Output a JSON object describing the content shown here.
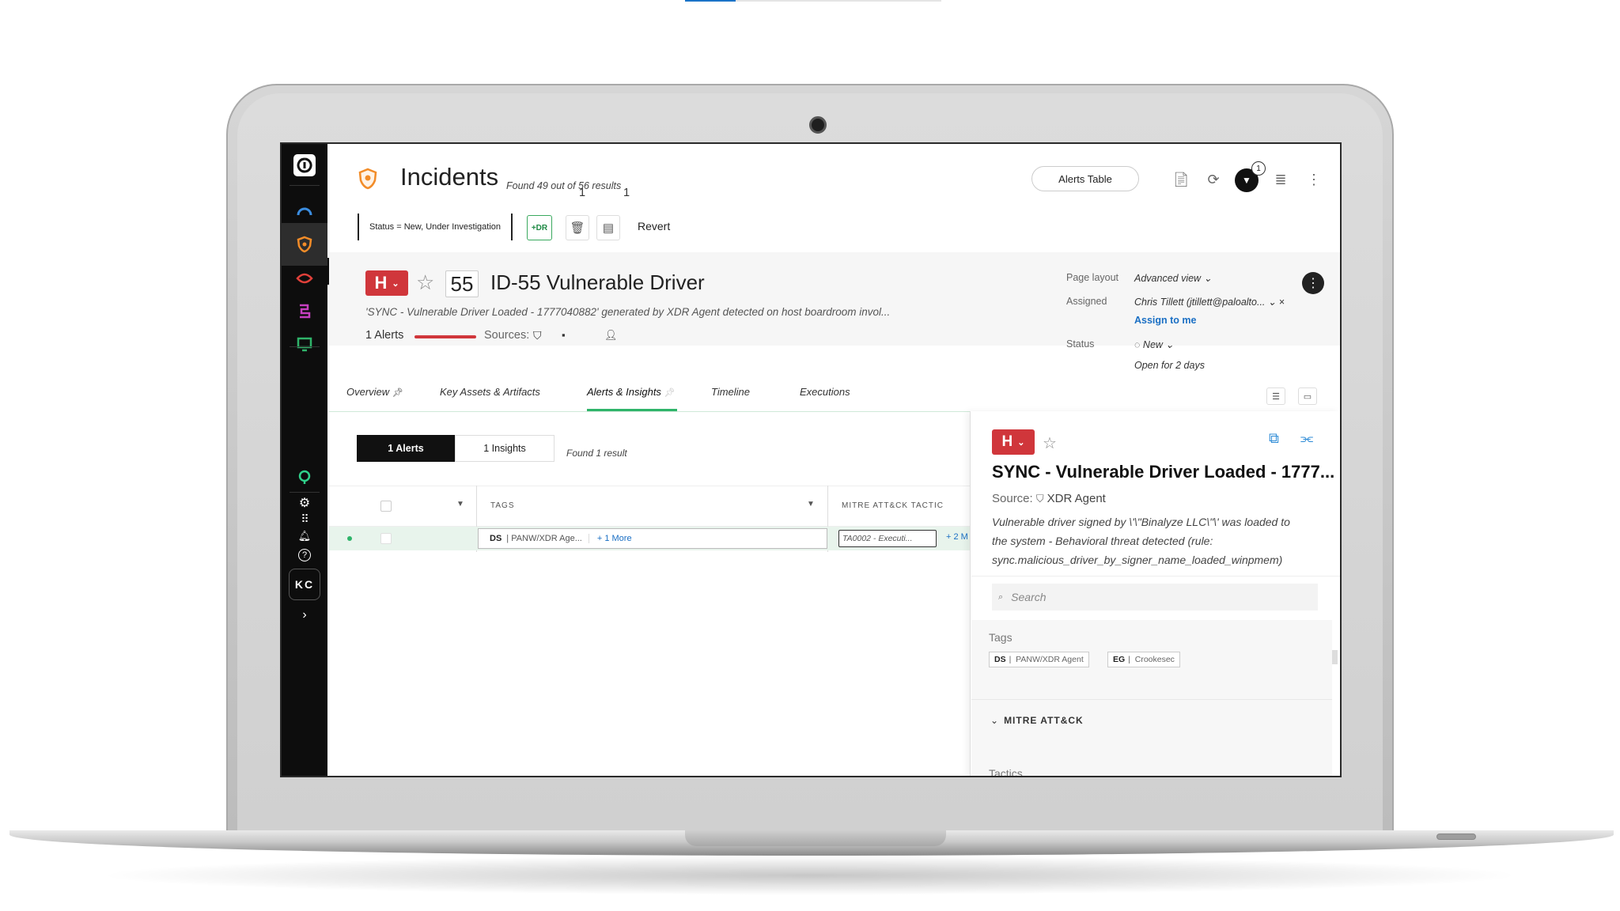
{
  "page": {
    "title": "Incidents",
    "found": "Found 49 out of 56 results"
  },
  "header": {
    "alerts_table": "Alerts Table",
    "notification_count": "1"
  },
  "filters": {
    "status_chip": "Status = New, Under Investigation",
    "xdr": "+DR",
    "revert": "Revert"
  },
  "nav": {
    "user_initials": "KC"
  },
  "incident": {
    "severity": "H",
    "number": "55",
    "title": "ID-55  Vulnerable Driver",
    "description": "'SYNC - Vulnerable Driver Loaded - 1777040882' generated by XDR Agent detected on host boardroom invol...",
    "alerts": "1 Alerts",
    "sources_label": "Sources:",
    "comment_count": "1",
    "user_count": "1"
  },
  "sidebar_fields": {
    "page_layout_label": "Page layout",
    "page_layout_value": "Advanced view",
    "assigned_label": "Assigned",
    "assigned_value": "Chris Tillett (jtillett@paloalto...",
    "assign_to_me": "Assign to me",
    "status_label": "Status",
    "status_value": "New",
    "open_for": "Open for 2 days"
  },
  "tabs": [
    "Overview",
    "Key Assets & Artifacts",
    "Alerts & Insights",
    "Timeline",
    "Executions"
  ],
  "alerts_view": {
    "toggle_alerts": "1 Alerts",
    "toggle_insights": "1 Insights",
    "found": "Found 1 result",
    "columns": [
      "TAGS",
      "MITRE ATT&CK TACTIC"
    ],
    "row": {
      "tag_key": "DS",
      "tag_value": "PANW/XDR Age...",
      "more": "+ 1 More",
      "tactic": "TA0002 - Executi...",
      "tactic_more": "+ 2 M"
    }
  },
  "panel": {
    "severity": "H",
    "title": "SYNC - Vulnerable Driver Loaded - 1777...",
    "source_label": "Source:",
    "source_value": "XDR Agent",
    "description": "Vulnerable driver signed by \\'\\\"Binalyze LLC\\\"\\' was loaded to the system - Behavioral threat detected (rule: sync.malicious_driver_by_signer_name_loaded_winpmem)",
    "search_placeholder": "Search",
    "tags_label": "Tags",
    "tags": [
      {
        "key": "DS",
        "value": "PANW/XDR Agent"
      },
      {
        "key": "EG",
        "value": "Crookesec"
      }
    ],
    "mitre_header": "MITRE ATT&CK",
    "tactics_label": "Tactics"
  },
  "colors": {
    "severity_high": "#d0363b",
    "accent_green": "#2fb46a",
    "link_blue": "#1a6fc4",
    "nav_bg": "#0d0d0d"
  }
}
